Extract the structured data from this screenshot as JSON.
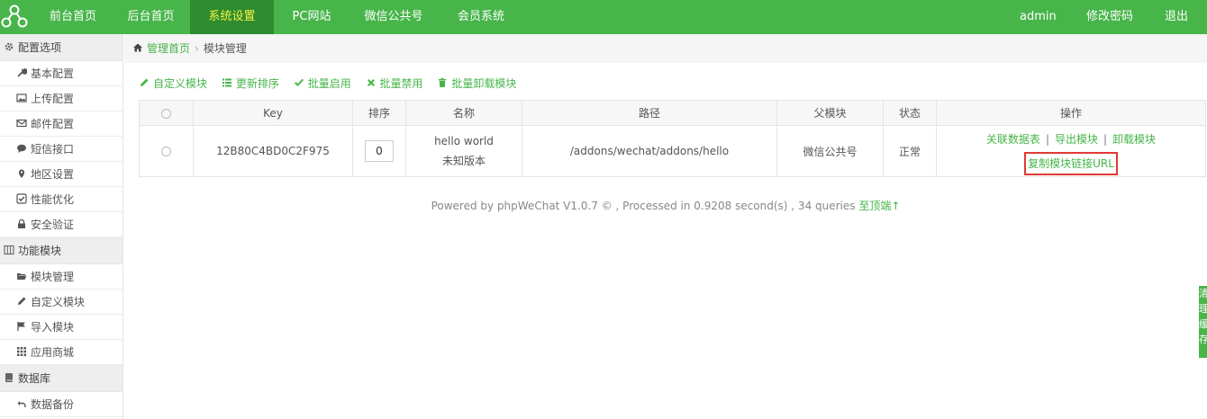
{
  "nav": {
    "items": [
      {
        "label": "前台首页"
      },
      {
        "label": "后台首页"
      },
      {
        "label": "系统设置",
        "active": true
      },
      {
        "label": "PC网站"
      },
      {
        "label": "微信公共号"
      },
      {
        "label": "会员系统"
      }
    ],
    "user": "admin",
    "change_password": "修改密码",
    "logout": "退出"
  },
  "sidebar": {
    "groups": [
      {
        "label": "配置选项",
        "icon": "gear-icon",
        "items": [
          {
            "label": "基本配置",
            "icon": "wrench-icon"
          },
          {
            "label": "上传配置",
            "icon": "image-icon"
          },
          {
            "label": "邮件配置",
            "icon": "envelope-icon"
          },
          {
            "label": "短信接口",
            "icon": "comment-icon"
          },
          {
            "label": "地区设置",
            "icon": "map-marker-icon"
          },
          {
            "label": "性能优化",
            "icon": "check-square-icon"
          },
          {
            "label": "安全验证",
            "icon": "lock-icon"
          }
        ]
      },
      {
        "label": "功能模块",
        "icon": "columns-icon",
        "items": [
          {
            "label": "模块管理",
            "icon": "folder-open-icon"
          },
          {
            "label": "自定义模块",
            "icon": "pencil-icon"
          },
          {
            "label": "导入模块",
            "icon": "flag-icon"
          },
          {
            "label": "应用商城",
            "icon": "grid-icon"
          }
        ]
      },
      {
        "label": "数据库",
        "icon": "book-icon",
        "items": [
          {
            "label": "数据备份",
            "icon": "undo-icon"
          }
        ]
      }
    ]
  },
  "breadcrumb": {
    "home": "管理首页",
    "current": "模块管理"
  },
  "toolbar": {
    "custom_module": "自定义模块",
    "update_order": "更新排序",
    "batch_enable": "批量启用",
    "batch_disable": "批量禁用",
    "batch_uninstall": "批量卸载模块"
  },
  "table": {
    "headers": [
      "Key",
      "排序",
      "名称",
      "路径",
      "父模块",
      "状态",
      "操作"
    ],
    "rows": [
      {
        "key": "12B80C4BD0C2F975",
        "order": "0",
        "name": "hello world",
        "version": "未知版本",
        "path": "/addons/wechat/addons/hello",
        "parent": "微信公共号",
        "status": "正常",
        "op_tables": "关联数据表",
        "op_export": "导出模块",
        "op_uninstall": "卸载模块",
        "op_copy_url": "复制模块链接URL"
      }
    ]
  },
  "footer": {
    "text": "Powered by phpWeChat V1.0.7 © , Processed in 0.9208 second(s) , 34 queries",
    "top_link": "至顶端↑"
  },
  "float_tab": {
    "label": "清理缓存"
  },
  "colors": {
    "brand": "#47b54a",
    "nav_active_bg": "#2e8b2f",
    "nav_active_text": "#f2f245",
    "highlight_border": "#e03a35"
  }
}
